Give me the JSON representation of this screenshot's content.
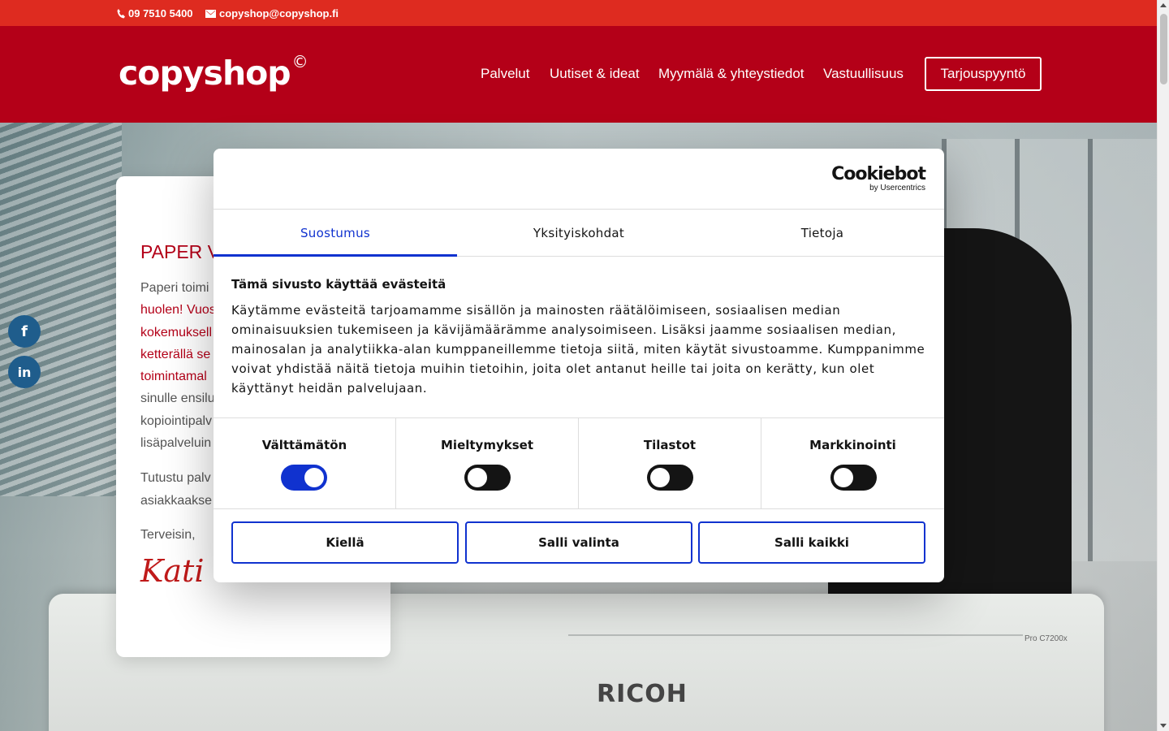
{
  "topbar": {
    "phone": "09 7510 5400",
    "email": "copyshop@copyshop.fi"
  },
  "header": {
    "logo_text": "copyshop",
    "logo_mark": "©",
    "nav": [
      "Palvelut",
      "Uutiset & ideat",
      "Myymälä & yhteystiedot",
      "Vastuullisuus"
    ],
    "cta_label": "Tarjouspyyntö"
  },
  "hero": {
    "printer_brand": "RICOH",
    "printer_model": "Pro C7200x"
  },
  "card": {
    "title": "PAPER V",
    "paragraph1_lines": [
      "Paperi toimi",
      "huolen! Vuos",
      "kokemuksell",
      "ketterällä se",
      "toimintamal",
      "sinulle ensilu",
      "kopiointipalv",
      "lisäpalveluin"
    ],
    "paragraph2_lines": [
      "Tutustu palv",
      "asiakkaakse"
    ],
    "greeting": "Terveisin,",
    "signature": "Kati"
  },
  "social": {
    "facebook": "f",
    "linkedin": "in"
  },
  "cookie_dialog": {
    "brand": "Cookiebot",
    "brand_sub": "by Usercentrics",
    "tabs": [
      "Suostumus",
      "Yksityiskohdat",
      "Tietoja"
    ],
    "active_tab": 0,
    "heading": "Tämä sivusto käyttää evästeitä",
    "body_lines": [
      "Käytämme evästeitä tarjoamamme sisällön ja mainosten räätälöimiseen, sosiaalisen median",
      "ominaisuuksien tukemiseen ja kävijämäärämme analysoimiseen. Lisäksi jaamme sosiaalisen median,",
      "mainosalan ja analytiikka-alan kumppaneillemme tietoja siitä, miten käytät sivustoamme. Kumppanimme",
      "voivat yhdistää näitä tietoja muihin tietoihin, joita olet antanut heille tai joita on kerätty, kun olet",
      "käyttänyt heidän palvelujaan."
    ],
    "categories": [
      {
        "label": "Välttämätön",
        "on": true
      },
      {
        "label": "Mieltymykset",
        "on": false
      },
      {
        "label": "Tilastot",
        "on": false
      },
      {
        "label": "Markkinointi",
        "on": false
      }
    ],
    "buttons": [
      "Kiellä",
      "Salli valinta",
      "Salli kaikki"
    ],
    "accent_color": "#1032cf"
  },
  "colors": {
    "topbar": "#de2b20",
    "header": "#b40018",
    "social": "#1f5d8c"
  }
}
